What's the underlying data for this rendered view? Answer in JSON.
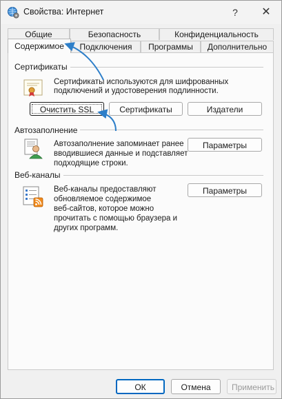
{
  "window": {
    "title": "Свойства: Интернет",
    "help_label": "?",
    "close_label": "✕",
    "app_icon": "globe-settings-icon"
  },
  "tabs": {
    "row_top": [
      {
        "label": "Общие"
      },
      {
        "label": "Безопасность"
      },
      {
        "label": "Конфиденциальность"
      }
    ],
    "row_bottom": [
      {
        "label": "Содержимое",
        "active": true
      },
      {
        "label": "Подключения"
      },
      {
        "label": "Программы"
      },
      {
        "label": "Дополнительно"
      }
    ]
  },
  "certificates": {
    "group_label": "Сертификаты",
    "icon": "certificate-icon",
    "description_line1": "Сертификаты используются для шифрованных",
    "description_line2": "подключений и удостоверения подлинности.",
    "clear_ssl_button": "Очистить SSL",
    "certificates_button": "Сертификаты",
    "publishers_button": "Издатели"
  },
  "autocomplete": {
    "group_label": "Автозаполнение",
    "icon": "autocomplete-user-icon",
    "description_line1": "Автозаполнение запоминает ранее",
    "description_line2": "вводившиеся данные и подставляет",
    "description_line3": "подходящие строки.",
    "settings_button": "Параметры"
  },
  "feeds": {
    "group_label": "Веб-каналы",
    "icon": "rss-feed-icon",
    "description_line1": "Веб-каналы предоставляют",
    "description_line2": "обновляемое содержимое",
    "description_line3": "веб-сайтов, которое можно",
    "description_line4": "прочитать с помощью браузера и",
    "description_line5": "других программ.",
    "settings_button": "Параметры"
  },
  "footer": {
    "ok_button": "ОК",
    "cancel_button": "Отмена",
    "apply_button": "Применить"
  },
  "colors": {
    "accent": "#0067c0",
    "annotation_arrow": "#2e7fc9"
  }
}
